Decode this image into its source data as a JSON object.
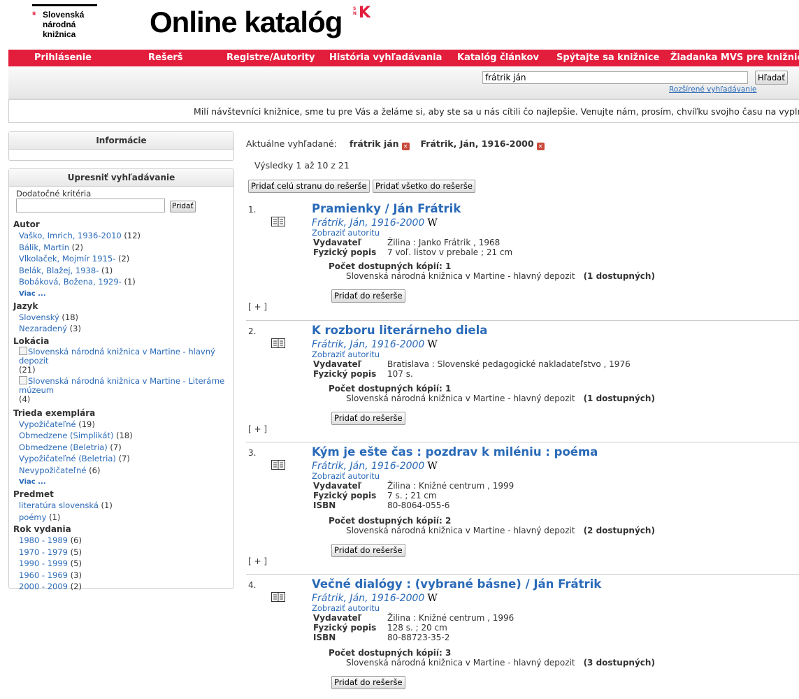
{
  "logo": {
    "line1": "Slovenská",
    "line2": "národná",
    "line3": "knižnica",
    "star": "*"
  },
  "app_title": "Online katalóg",
  "snk_mark": {
    "s": "S",
    "n": "N",
    "k": "K"
  },
  "nav": [
    "Prihlásenie",
    "Rešerš",
    "Registre/Autority",
    "História vyhľadávania",
    "Katalóg článkov",
    "Spýtajte sa knižnice",
    "Žiadanka MVS pre knižnice"
  ],
  "search": {
    "value": "frátrik ján",
    "button": "Hľadať",
    "advanced": "Rozšírené vyhľadávanie"
  },
  "notice": "Milí návštevníci knižnice, sme tu pre Vás a želáme si, aby ste sa u nás cítili čo najlepšie. Venujte nám, prosím, chvíľku svojho času na vyplnenie d",
  "sidebar": {
    "info_title": "Informácie",
    "refine_title": "Upresniť vyhľadávanie",
    "criteria_label": "Dodatočné kritéria",
    "criteria_button": "Pridať",
    "author": {
      "title": "Autor",
      "items": [
        {
          "name": "Vaško, Imrich, 1936-2010",
          "count": "(12)"
        },
        {
          "name": "Bálik, Martin",
          "count": "(2)"
        },
        {
          "name": "Vlkolaček, Mojmír 1915-",
          "count": "(2)"
        },
        {
          "name": "Belák, Blažej, 1938-",
          "count": "(1)"
        },
        {
          "name": "Bobáková, Božena, 1929-",
          "count": "(1)"
        }
      ],
      "more": "Viac ..."
    },
    "language": {
      "title": "Jazyk",
      "items": [
        {
          "name": "Slovenský",
          "count": "(18)"
        },
        {
          "name": "Nezaradený",
          "count": "(3)"
        }
      ]
    },
    "location": {
      "title": "Lokácia",
      "items": [
        {
          "l1": "Slovenská národná knižnica v Martine - hlavný",
          "l2": "depozit",
          "count": "(21)"
        },
        {
          "l1": "Slovenská národná knižnica v Martine - Literárne",
          "l2": "múzeum",
          "count": "(4)"
        }
      ]
    },
    "class": {
      "title": "Trieda exemplára",
      "items": [
        {
          "name": "Vypožičateľné",
          "count": "(19)"
        },
        {
          "name": "Obmedzene (Simplikát)",
          "count": "(18)"
        },
        {
          "name": "Obmedzene (Beletria)",
          "count": "(7)"
        },
        {
          "name": "Vypožičateľné (Beletria)",
          "count": "(7)"
        },
        {
          "name": "Nevypožičateľné",
          "count": "(6)"
        }
      ],
      "more": "Viac ..."
    },
    "subject": {
      "title": "Predmet",
      "items": [
        {
          "name": "literatúra slovenská",
          "count": "(1)"
        },
        {
          "name": "poémy",
          "count": "(1)"
        }
      ]
    },
    "year": {
      "title": "Rok vydania",
      "items": [
        {
          "name": "1980 - 1989",
          "count": "(6)"
        },
        {
          "name": "1970 - 1979",
          "count": "(5)"
        },
        {
          "name": "1990 - 1999",
          "count": "(5)"
        },
        {
          "name": "1960 - 1969",
          "count": "(3)"
        },
        {
          "name": "2000 - 2009",
          "count": "(2)"
        }
      ]
    }
  },
  "current": {
    "label": "Aktuálne vyhľadané:",
    "term1": "frátrik ján",
    "term2": "Frátrik, Ján, 1916-2000"
  },
  "results_count": "Výsledky 1 až 10 z 21",
  "buttons": {
    "add_page": "Pridať celú stranu do rešerše",
    "add_all": "Pridať všetko do rešerše",
    "add_one": "Pridať do rešerše",
    "expand": "[ + ]"
  },
  "labels": {
    "publisher": "Vydavateľ",
    "physical": "Fyzický popis",
    "isbn": "ISBN",
    "copies": "Počet dostupných kópií:",
    "show_authority": "Zobraziť autoritu",
    "wiki": "W"
  },
  "records": [
    {
      "num": "1.",
      "title": "Pramienky / Ján Frátrik",
      "author": "Frátrik, Ján, 1916-2000",
      "publisher": "Žilina : Janko Frátrik , 1968",
      "physical": "7 voľ. listov v prebale ; 21 cm",
      "copies": "1",
      "location": "Slovenská národná knižnica v Martine - hlavný depozit",
      "available": "(1 dostupných)"
    },
    {
      "num": "2.",
      "title": "K rozboru literárneho diela",
      "author": "Frátrik, Ján, 1916-2000",
      "publisher": "Bratislava : Slovenské pedagogické nakladateľstvo , 1976",
      "physical": "107 s.",
      "copies": "1",
      "location": "Slovenská národná knižnica v Martine - hlavný depozit",
      "available": "(1 dostupných)"
    },
    {
      "num": "3.",
      "title": "Kým je ešte čas : pozdrav k miléniu : poéma",
      "author": "Frátrik, Ján, 1916-2000",
      "publisher": "Žilina : Knižné centrum , 1999",
      "physical": "7 s. ; 21 cm",
      "isbn": "80-8064-055-6",
      "copies": "2",
      "location": "Slovenská národná knižnica v Martine - hlavný depozit",
      "available": "(2 dostupných)"
    },
    {
      "num": "4.",
      "title": "Večné dialógy : (vybrané básne) / Ján Frátrik",
      "author": "Frátrik, Ján, 1916-2000",
      "publisher": "Žilina : Knižné centrum , 1996",
      "physical": "128 s. ; 20 cm",
      "isbn": "80-88723-35-2",
      "copies": "3",
      "location": "Slovenská národná knižnica v Martine - hlavný depozit",
      "available": "(3 dostupných)"
    }
  ]
}
